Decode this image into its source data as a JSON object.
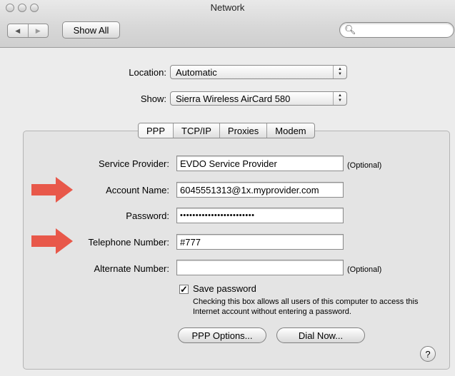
{
  "window": {
    "title": "Network"
  },
  "toolbar": {
    "back_icon": "back-arrow",
    "forward_icon": "forward-arrow",
    "show_all_label": "Show All",
    "search_placeholder": "",
    "search_value": ""
  },
  "location": {
    "label": "Location:",
    "value": "Automatic"
  },
  "show": {
    "label": "Show:",
    "value": "Sierra Wireless AirCard 580"
  },
  "tabs": [
    {
      "label": "PPP",
      "active": true
    },
    {
      "label": "TCP/IP",
      "active": false
    },
    {
      "label": "Proxies",
      "active": false
    },
    {
      "label": "Modem",
      "active": false
    }
  ],
  "form": {
    "service_provider": {
      "label": "Service Provider:",
      "value": "EVDO Service Provider",
      "note": "(Optional)"
    },
    "account_name": {
      "label": "Account Name:",
      "value": "6045551313@1x.myprovider.com"
    },
    "password": {
      "label": "Password:",
      "value": "••••••••••••••••••••••••"
    },
    "telephone_number": {
      "label": "Telephone Number:",
      "value": "#777"
    },
    "alternate_number": {
      "label": "Alternate Number:",
      "value": "",
      "note": "(Optional)"
    }
  },
  "save_password": {
    "checked": true,
    "label": "Save password",
    "description": "Checking this box allows all users of this computer to access this Internet account without entering a password."
  },
  "buttons": {
    "ppp_options": "PPP Options...",
    "dial_now": "Dial Now..."
  },
  "help": {
    "label": "?"
  },
  "colors": {
    "annotation_arrow": "#e8584a",
    "window_bg": "#ececec"
  }
}
